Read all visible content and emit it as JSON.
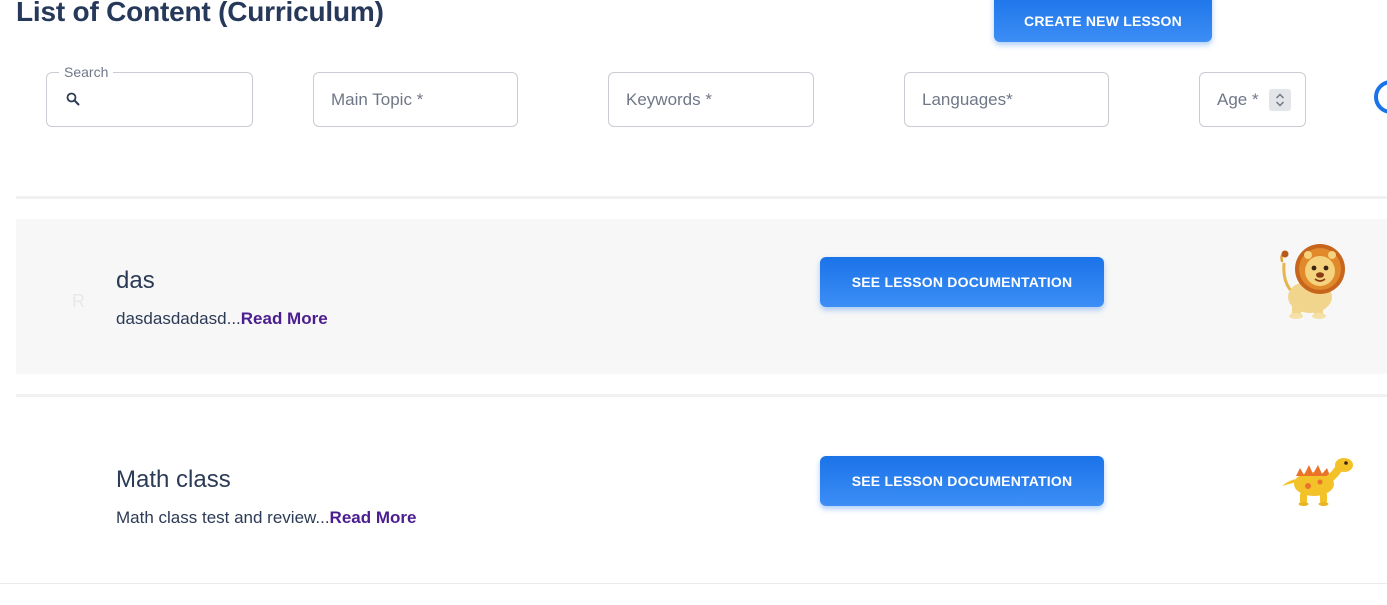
{
  "header": {
    "title": "List of Content (Curriculum)",
    "create_button": "CREATE NEW LESSON"
  },
  "filters": {
    "search_legend": "Search",
    "search_value": "",
    "main_topic_placeholder": "Main Topic *",
    "keywords_placeholder": "Keywords *",
    "languages_placeholder": "Languages*",
    "age_placeholder": "Age *"
  },
  "lessons": [
    {
      "avatar_letter": "R",
      "title": "das",
      "description": "dasdasdadasd...",
      "read_more": "Read More",
      "button": "SEE LESSON DOCUMENTATION",
      "icon": "lion-icon"
    },
    {
      "title": "Math class",
      "description": "Math class test and review...",
      "read_more": "Read More",
      "button": "SEE LESSON DOCUMENTATION",
      "icon": "dinosaur-icon"
    }
  ],
  "colors": {
    "primary": "#1a73e8",
    "title_text": "#26395a",
    "read_more": "#4b1d8f",
    "row_gray": "#f7f7f7"
  }
}
